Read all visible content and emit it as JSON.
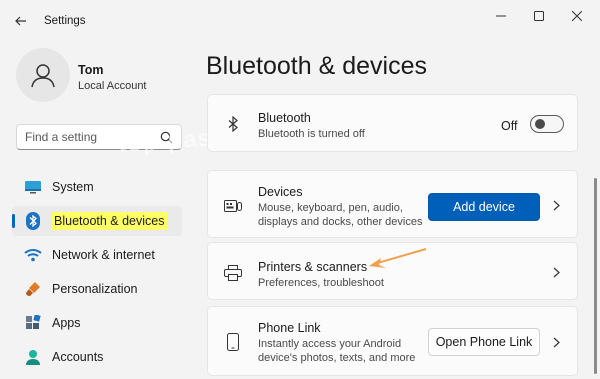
{
  "window": {
    "title": "Settings"
  },
  "profile": {
    "name": "Tom",
    "account_type": "Local Account"
  },
  "search": {
    "placeholder": "Find a setting"
  },
  "watermark": "top-password.com",
  "sidebar": {
    "items": [
      {
        "label": "System",
        "icon": "monitor-icon"
      },
      {
        "label": "Bluetooth & devices",
        "icon": "bluetooth-icon",
        "active": true
      },
      {
        "label": "Network & internet",
        "icon": "wifi-icon"
      },
      {
        "label": "Personalization",
        "icon": "brush-icon"
      },
      {
        "label": "Apps",
        "icon": "apps-icon"
      },
      {
        "label": "Accounts",
        "icon": "person-icon"
      }
    ]
  },
  "main": {
    "title": "Bluetooth & devices",
    "cards": {
      "bluetooth": {
        "title": "Bluetooth",
        "subtitle": "Bluetooth is turned off",
        "toggle_label": "Off",
        "toggle_on": false
      },
      "devices": {
        "title": "Devices",
        "subtitle_line1": "Mouse, keyboard, pen, audio,",
        "subtitle_line2": "displays and docks, other devices",
        "button_label": "Add device"
      },
      "printers": {
        "title": "Printers & scanners",
        "subtitle": "Preferences, troubleshoot"
      },
      "phone": {
        "title": "Phone Link",
        "subtitle_line1": "Instantly access your Android",
        "subtitle_line2": "device's photos, texts, and more",
        "button_label": "Open Phone Link"
      }
    }
  },
  "colors": {
    "accent": "#005fb8",
    "highlight": "#ffff66",
    "annotation_arrow": "#f0a050"
  }
}
